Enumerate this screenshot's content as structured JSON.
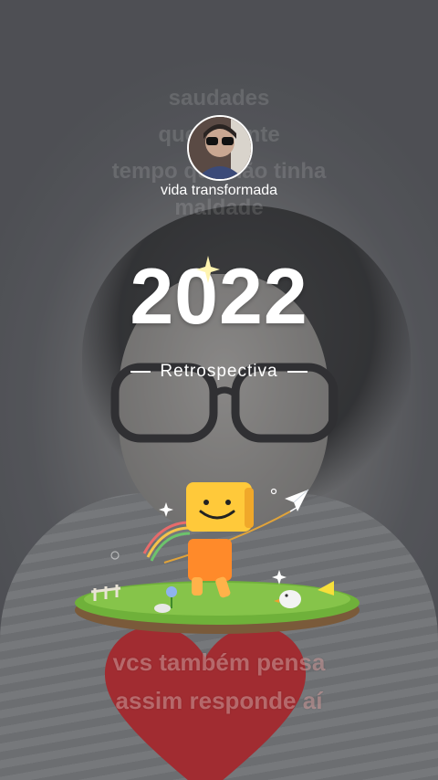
{
  "ghost_text": {
    "line1": "saudades",
    "line2": "que a gente",
    "line3": "tempo que não tinha",
    "line4": "maldade"
  },
  "profile": {
    "username": "vida transformada"
  },
  "retrospective": {
    "year": "2022",
    "label": "Retrospectiva"
  },
  "caption": {
    "line1": "vcs também pensa",
    "line2": "assim responde aí"
  },
  "colors": {
    "heart": "#c8262b",
    "grass": "#6fb13a",
    "mascot": "#ffc93a"
  },
  "icons": {
    "sparkle": "sparkle-icon",
    "plane": "paper-plane-icon",
    "mascot": "smiley-mascot-icon"
  }
}
